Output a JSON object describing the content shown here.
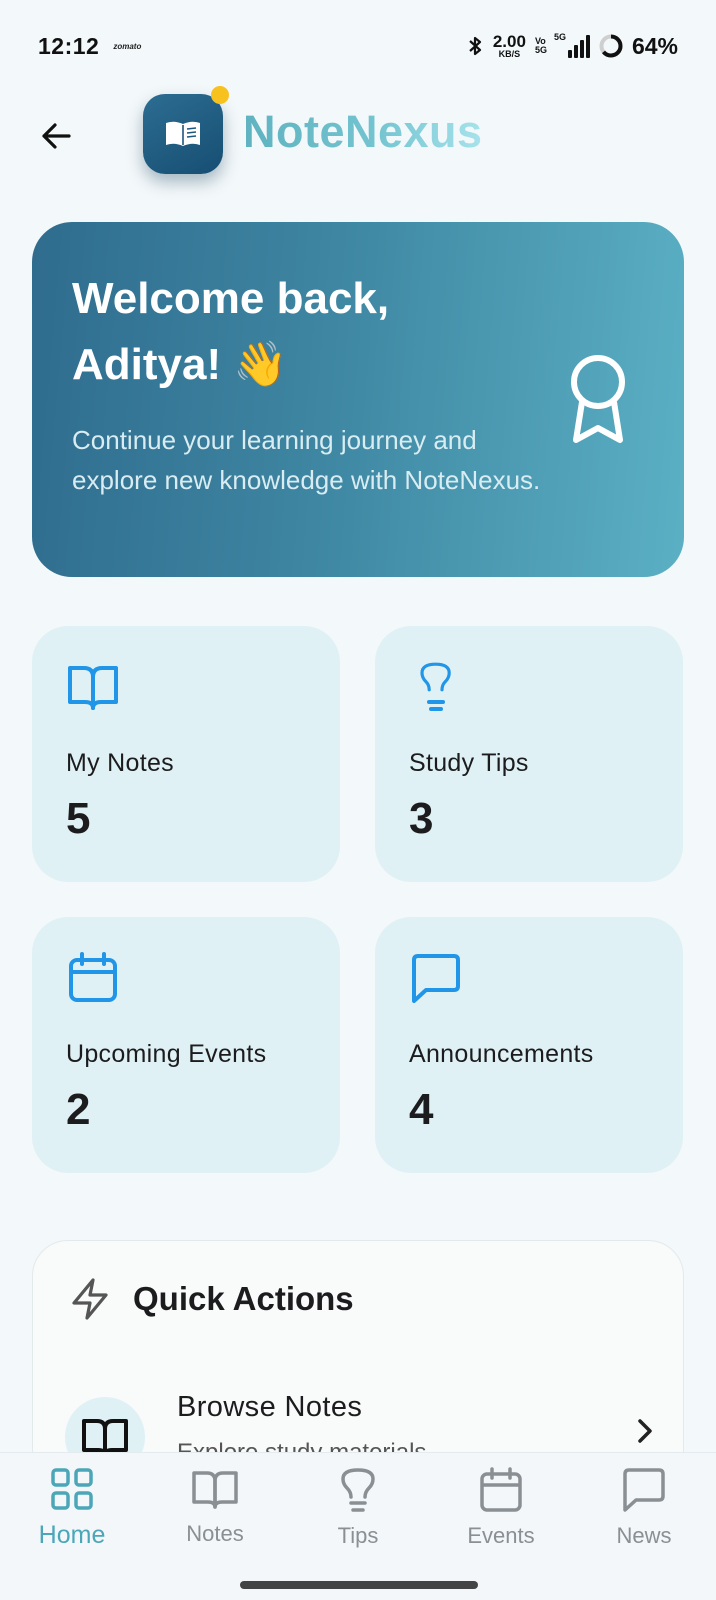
{
  "status_bar": {
    "time": "12:12",
    "app_notification": "zomato",
    "net_speed_value": "2.00",
    "net_speed_unit": "KB/S",
    "volte_top": "Vo",
    "volte_bottom": "5G",
    "network_type": "5G",
    "battery_percent": "64%",
    "battery_level": 0.64
  },
  "header": {
    "app_title": "NoteNexus"
  },
  "welcome": {
    "title_line1": "Welcome back,",
    "title_line2": "Aditya! 👋",
    "subtitle": "Continue your learning journey and explore new knowledge with NoteNexus."
  },
  "stats": [
    {
      "label": "My Notes",
      "value": "5",
      "icon": "book-open-icon"
    },
    {
      "label": "Study Tips",
      "value": "3",
      "icon": "lightbulb-icon"
    },
    {
      "label": "Upcoming Events",
      "value": "2",
      "icon": "calendar-icon"
    },
    {
      "label": "Announcements",
      "value": "4",
      "icon": "message-square-icon"
    }
  ],
  "quick_actions": {
    "title": "Quick Actions",
    "items": [
      {
        "title": "Browse Notes",
        "subtitle": "Explore study materials"
      }
    ]
  },
  "bottom_nav": [
    {
      "label": "Home",
      "icon": "grid-icon",
      "active": true
    },
    {
      "label": "Notes",
      "icon": "book-open-icon",
      "active": false
    },
    {
      "label": "Tips",
      "icon": "lightbulb-icon",
      "active": false
    },
    {
      "label": "Events",
      "icon": "calendar-icon",
      "active": false
    },
    {
      "label": "News",
      "icon": "message-square-icon",
      "active": false
    }
  ],
  "colors": {
    "background": "#f3f8fa",
    "accent": "#4ba6b8",
    "card_tint": "#dff1f5",
    "icon_blue": "#2196e8",
    "logo_dot": "#f7c21e"
  }
}
